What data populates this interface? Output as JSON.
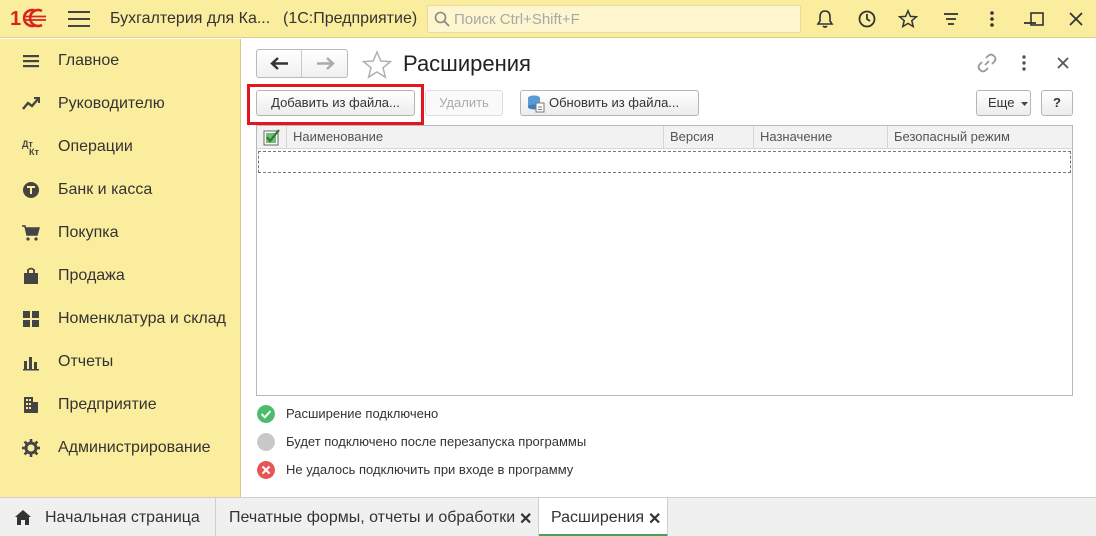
{
  "app": {
    "logo": "1С",
    "title": "Бухгалтерия для Ка...",
    "platform": "(1С:Предприятие)",
    "search_placeholder": "Поиск Ctrl+Shift+F"
  },
  "titlebar_icons": [
    "bell-icon",
    "history-icon",
    "star-icon",
    "menu-lines-icon",
    "more-vertical-icon",
    "minimize-icon",
    "maximize-icon",
    "close-icon"
  ],
  "sidebar": {
    "items": [
      {
        "label": "Главное",
        "icon": "list-icon"
      },
      {
        "label": "Руководителю",
        "icon": "trend-icon"
      },
      {
        "label": "Операции",
        "icon": "dt-kt-icon"
      },
      {
        "label": "Банк и касса",
        "icon": "coin-icon"
      },
      {
        "label": "Покупка",
        "icon": "cart-icon"
      },
      {
        "label": "Продажа",
        "icon": "bag-icon"
      },
      {
        "label": "Номенклатура и склад",
        "icon": "grid-icon"
      },
      {
        "label": "Отчеты",
        "icon": "bar-chart-icon"
      },
      {
        "label": "Предприятие",
        "icon": "building-icon"
      },
      {
        "label": "Администрирование",
        "icon": "gear-icon"
      }
    ]
  },
  "form": {
    "title": "Расширения",
    "buttons": {
      "add_from_file": "Добавить из файла...",
      "delete": "Удалить",
      "update_from_file": "Обновить из файла...",
      "more": "Еще",
      "help": "?"
    },
    "columns": [
      "Наименование",
      "Версия",
      "Назначение",
      "Безопасный режим"
    ],
    "legend": [
      {
        "text": "Расширение подключено",
        "color": "#4cbb6c"
      },
      {
        "text": "Будет подключено после перезапуска программы",
        "color": "#c8c8c8"
      },
      {
        "text": "Не удалось подключить при входе в программу",
        "color": "#e55656"
      }
    ]
  },
  "tabs": [
    {
      "label": "Начальная страница",
      "icon": "home-icon"
    },
    {
      "label": "Печатные формы, отчеты и обработки",
      "closable": true
    },
    {
      "label": "Расширения",
      "closable": true,
      "active": true
    }
  ],
  "colors": {
    "accent_yellow": "#fbed9e",
    "highlight_red": "#e2161c",
    "active_tab_green": "#4aa05a"
  }
}
